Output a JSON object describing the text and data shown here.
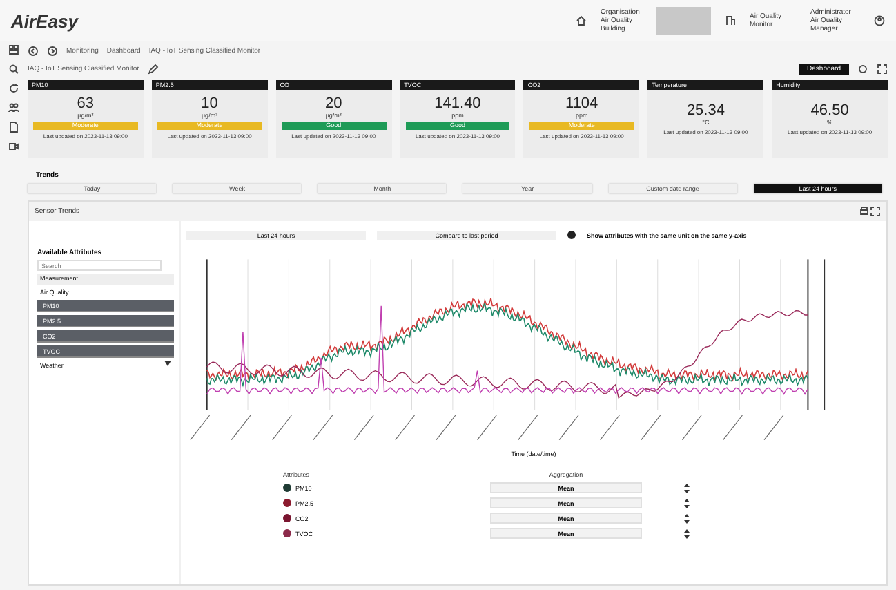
{
  "header": {
    "logo": "AirEasy",
    "site": "Organisation Air Quality Building",
    "location": "Air Quality Monitor",
    "user": "Administrator",
    "role": "Air Quality Manager"
  },
  "breadcrumb": [
    "Monitoring",
    "Dashboard",
    "IAQ - IoT Sensing Classified Monitor"
  ],
  "subtitle": "IAQ - IoT Sensing Classified Monitor",
  "toolbar_button": "Dashboard",
  "cards": [
    {
      "title": "PM10",
      "value": "63",
      "unit": "µg/m³",
      "status": {
        "label": "Moderate",
        "color": "#e8b923"
      },
      "updated": "Last updated on 2023-11-13 09:00"
    },
    {
      "title": "PM2.5",
      "value": "10",
      "unit": "µg/m³",
      "status": {
        "label": "Moderate",
        "color": "#e8b923"
      },
      "updated": "Last updated on 2023-11-13 09:00"
    },
    {
      "title": "CO",
      "value": "20",
      "unit": "µg/m³",
      "status": {
        "label": "Good",
        "color": "#1e9b57"
      },
      "updated": "Last updated on 2023-11-13 09:00"
    },
    {
      "title": "TVOC",
      "value": "141.40",
      "unit": "ppm",
      "status": {
        "label": "Good",
        "color": "#1e9b57"
      },
      "updated": "Last updated on 2023-11-13 09:00"
    },
    {
      "title": "CO2",
      "value": "1104",
      "unit": "ppm",
      "status": {
        "label": "Moderate",
        "color": "#e8b923"
      },
      "updated": "Last updated on 2023-11-13 09:00"
    },
    {
      "title": "Temperature",
      "value": "25.34",
      "unit": "°C",
      "updated": "Last updated on 2023-11-13 09:00"
    },
    {
      "title": "Humidity",
      "value": "46.50",
      "unit": "%",
      "updated": "Last updated on 2023-11-13 09:00"
    }
  ],
  "trends_label": "Trends",
  "ranges": [
    {
      "label": "Today",
      "selected": false
    },
    {
      "label": "Week",
      "selected": false
    },
    {
      "label": "Month",
      "selected": false
    },
    {
      "label": "Year",
      "selected": false
    },
    {
      "label": "Custom date range",
      "selected": false
    },
    {
      "label": "Last 24 hours",
      "selected": true
    }
  ],
  "panel": {
    "title": "Sensor Trends",
    "sidebar": {
      "title": "Available Attributes",
      "search_placeholder": "Search",
      "dropdown": "Measurement",
      "groups": [
        {
          "label": "Air Quality",
          "expanded": true,
          "children": [
            {
              "label": "PM10",
              "selected": true
            },
            {
              "label": "PM2.5",
              "selected": true
            },
            {
              "label": "CO2",
              "selected": true
            },
            {
              "label": "TVOC",
              "selected": true
            }
          ]
        },
        {
          "label": "Weather",
          "expanded": false
        }
      ]
    },
    "chart_buttons": [
      "Last 24 hours",
      "Compare to last period"
    ],
    "same_axis": {
      "label": "Show attributes with the same unit on the same y-axis",
      "checked": true
    },
    "xlabel": "Time (date/time)",
    "legend": {
      "col_attributes": "Attributes",
      "col_aggregation": "Aggregation",
      "rows": [
        {
          "name": "PM10",
          "color": "#1f3b34",
          "aggregation": "Mean"
        },
        {
          "name": "PM2.5",
          "color": "#8b1a2e",
          "aggregation": "Mean"
        },
        {
          "name": "CO2",
          "color": "#7a1530",
          "aggregation": "Mean"
        },
        {
          "name": "TVOC",
          "color": "#8c2a4a",
          "aggregation": "Mean"
        }
      ]
    }
  }
}
